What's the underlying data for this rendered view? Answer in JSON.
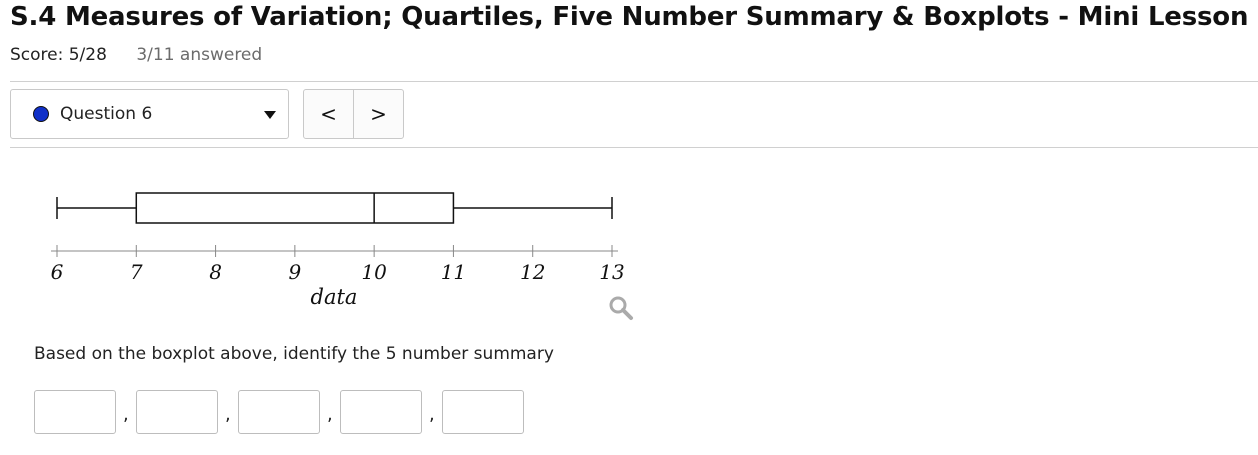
{
  "header": {
    "title": "S.4 Measures of Variation; Quartiles, Five Number Summary & Boxplots - Mini Lesson",
    "score": "Score: 5/28",
    "answered": "3/11 answered"
  },
  "question_nav": {
    "current": "Question 6",
    "status_color": "#1030c8",
    "prev_symbol": "<",
    "next_symbol": ">"
  },
  "chart_data": {
    "type": "boxplot",
    "xlabel": "data",
    "xlim": [
      6,
      13
    ],
    "ticks": [
      6,
      7,
      8,
      9,
      10,
      11,
      12,
      13
    ],
    "min": 6,
    "q1": 7,
    "median": 10,
    "q3": 11,
    "max": 13
  },
  "question": {
    "prompt": "Based on the boxplot above, identify the 5 number summary",
    "answers": [
      "",
      "",
      "",
      "",
      ""
    ],
    "separator": ","
  }
}
